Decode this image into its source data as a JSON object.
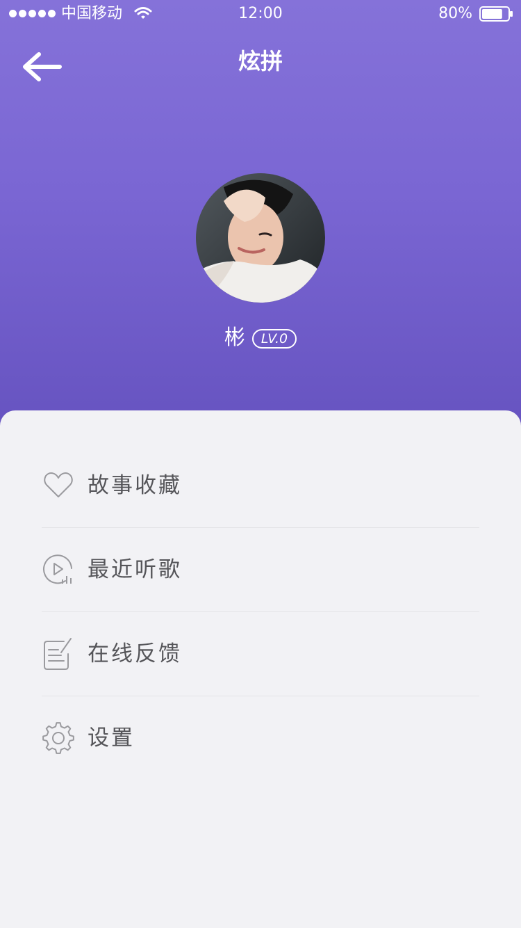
{
  "status_bar": {
    "carrier": "中国移动",
    "time": "12:00",
    "battery": "80%",
    "battery_level": 0.8
  },
  "nav": {
    "title": "炫拼",
    "back_icon": "arrow-left-icon"
  },
  "profile": {
    "username": "彬",
    "level": "LV.0"
  },
  "menu": [
    {
      "label": "故事收藏",
      "icon": "heart-icon"
    },
    {
      "label": "最近听歌",
      "icon": "play-history-icon"
    },
    {
      "label": "在线反馈",
      "icon": "feedback-icon"
    },
    {
      "label": "设置",
      "icon": "gear-icon"
    }
  ],
  "colors": {
    "header_gradient_top": "#8572d9",
    "header_gradient_bottom": "#6653c0",
    "panel_bg": "#f2f2f5",
    "label_text": "#555559",
    "icon_stroke": "#9a9a9e"
  }
}
